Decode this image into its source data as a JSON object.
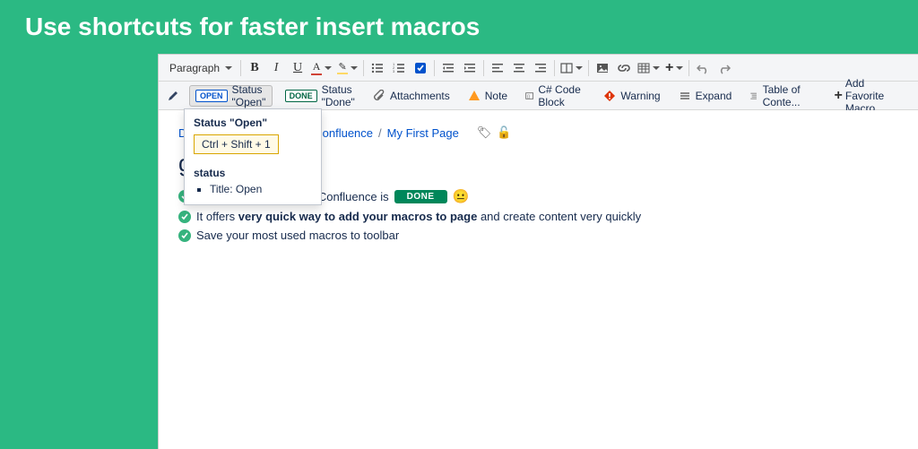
{
  "banner": {
    "title": "Use shortcuts for faster insert macros"
  },
  "toolbar1": {
    "paragraph_label": "Paragraph"
  },
  "toolbar2": {
    "status_open_label": "Status \"Open\"",
    "status_done_label": "Status \"Done\"",
    "attachments_label": "Attachments",
    "note_label": "Note",
    "code_label": "C# Code Block",
    "warning_label": "Warning",
    "expand_label": "Expand",
    "toc_label": "Table of Conte...",
    "add_fav_label": "Add Favorite Macro",
    "status_open_badge": "OPEN",
    "status_done_badge": "DONE"
  },
  "breadcrumbs": {
    "dashboard": "Dashboard",
    "space": "Welcome to Confluence",
    "page": "My First Page"
  },
  "page": {
    "title_fragment": "ge"
  },
  "lines": {
    "l1_prefix": "App Favorite Macro for Confluence is",
    "l1_badge": "DONE",
    "l1_emoji": "😐",
    "l2_a": "It offers ",
    "l2_b": "very quick way to add your macros to page",
    "l2_c": " and create content very quickly",
    "l3": "Save your most used macros to toolbar"
  },
  "popover": {
    "title": "Status \"Open\"",
    "shortcut": "Ctrl + Shift + 1",
    "subtitle": "status",
    "param_label": "Title:",
    "param_value": "Open"
  }
}
